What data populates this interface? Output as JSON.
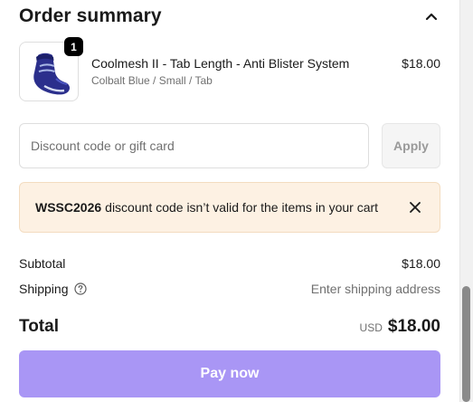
{
  "summary": {
    "title": "Order summary",
    "toggle_icon": "chevron-up-icon"
  },
  "product": {
    "quantity": "1",
    "name": "Coolmesh II - Tab Length - Anti Blister System",
    "variant": "Colbalt Blue / Small / Tab",
    "price": "$18.00",
    "image_icon": "sock-image"
  },
  "discount": {
    "placeholder": "Discount code or gift card",
    "value": "",
    "apply_label": "Apply"
  },
  "alert": {
    "code": "WSSC2026",
    "message": "discount code isn’t valid for the items in your cart",
    "close_icon": "close-icon"
  },
  "totals": {
    "subtotal_label": "Subtotal",
    "subtotal_value": "$18.00",
    "shipping_label": "Shipping",
    "shipping_help_icon": "question-circle-icon",
    "shipping_value": "Enter shipping address",
    "total_label": "Total",
    "currency": "USD",
    "total_value": "$18.00"
  },
  "actions": {
    "pay_label": "Pay now"
  },
  "colors": {
    "pay_button": "#a996f5",
    "alert_background": "#fdf1e3",
    "badge": "#000000"
  }
}
